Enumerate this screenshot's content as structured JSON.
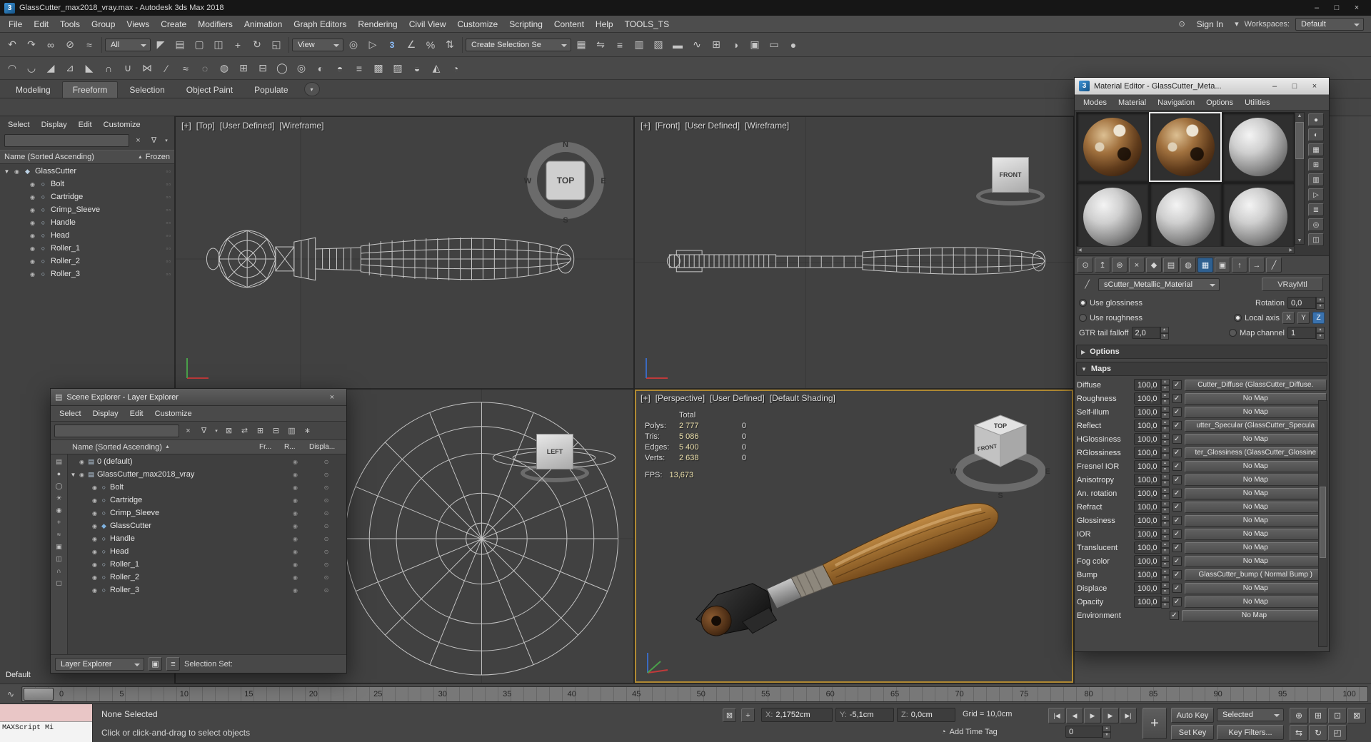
{
  "icons": {
    "eye": "◉",
    "gear": "▫▫",
    "render_col": "◉",
    "display_col": "⊙",
    "search_clear": "×",
    "funnel": "∇",
    "caret_down": "▾",
    "sort_asc": "▲",
    "check": "✓",
    "spin_up": "▲",
    "spin_down": "▼",
    "scroll_up": "▲",
    "scroll_down": "▼",
    "scroll_left": "◀",
    "scroll_right": "▶",
    "eyedropper": "╱",
    "person": "⊙",
    "lock": "⊠",
    "offset_mode": "+",
    "clock": "◔",
    "minicurve": "∿",
    "layer": "▤"
  },
  "titlebar": {
    "app_icon": "3",
    "title": "GlassCutter_max2018_vray.max - Autodesk 3ds Max 2018",
    "minimize": "–",
    "maximize": "□",
    "close": "×"
  },
  "menubar": {
    "items": [
      "File",
      "Edit",
      "Tools",
      "Group",
      "Views",
      "Create",
      "Modifiers",
      "Animation",
      "Graph Editors",
      "Rendering",
      "Civil View",
      "Customize",
      "Scripting",
      "Content",
      "Help",
      "TOOLS_TS"
    ],
    "sign_in": "Sign In",
    "workspaces_label": "Workspaces:",
    "workspace_value": "Default"
  },
  "toolbar_main": {
    "filter_dropdown": "All",
    "coords_dropdown": "View",
    "named_sets_dropdown": "Create Selection Se",
    "left_icons": [
      {
        "name": "undo-icon",
        "glyph": "↶"
      },
      {
        "name": "redo-icon",
        "glyph": "↷"
      },
      {
        "name": "select-and-link-icon",
        "glyph": "∞"
      },
      {
        "name": "unlink-selection-icon",
        "glyph": "⊘"
      },
      {
        "name": "bind-to-space-warp-icon",
        "glyph": "≈"
      }
    ],
    "select_icons": [
      {
        "name": "select-object-icon",
        "glyph": "◤"
      },
      {
        "name": "select-by-name-icon",
        "glyph": "▤"
      },
      {
        "name": "rectangular-selection-icon",
        "glyph": "▢"
      },
      {
        "name": "window-crossing-icon",
        "glyph": "◫"
      },
      {
        "name": "select-and-move-icon",
        "glyph": "+"
      },
      {
        "name": "select-and-rotate-icon",
        "glyph": "↻"
      },
      {
        "name": "select-and-scale-icon",
        "glyph": "◱"
      }
    ],
    "mid_icons": [
      {
        "name": "use-pivot-center-icon",
        "glyph": "◎"
      },
      {
        "name": "select-and-manipulate-icon",
        "glyph": "▷"
      },
      {
        "name": "snap-toggle-icon",
        "glyph": "3",
        "class": "snap"
      },
      {
        "name": "angle-snap-icon",
        "glyph": "∠"
      },
      {
        "name": "percent-snap-icon",
        "glyph": "%"
      },
      {
        "name": "spinner-snap-icon",
        "glyph": "⇅"
      }
    ],
    "right_icons": [
      {
        "name": "edit-named-selections-icon",
        "glyph": "▦"
      },
      {
        "name": "mirror-icon",
        "glyph": "⇋"
      },
      {
        "name": "align-icon",
        "glyph": "≡"
      },
      {
        "name": "toggle-scene-explorer-icon",
        "glyph": "▥"
      },
      {
        "name": "toggle-layer-explorer-icon",
        "glyph": "▧"
      },
      {
        "name": "toggle-ribbon-icon",
        "glyph": "▬"
      },
      {
        "name": "curve-editor-icon",
        "glyph": "∿"
      },
      {
        "name": "schematic-view-icon",
        "glyph": "⊞"
      },
      {
        "name": "material-editor-icon",
        "glyph": "◑"
      },
      {
        "name": "render-setup-icon",
        "glyph": "▣"
      },
      {
        "name": "rendered-frame-window-icon",
        "glyph": "▭"
      },
      {
        "name": "render-production-icon",
        "glyph": "●"
      }
    ]
  },
  "toolbar_second": {
    "icons": [
      {
        "name": "paint-connect-icon",
        "glyph": "◠"
      },
      {
        "name": "swift-loop-icon",
        "glyph": "◡"
      },
      {
        "name": "chamfer-icon",
        "glyph": "◢"
      },
      {
        "name": "extrude-icon",
        "glyph": "⊿"
      },
      {
        "name": "bevel-icon",
        "glyph": "◣"
      },
      {
        "name": "bridge-icon",
        "glyph": "∩"
      },
      {
        "name": "weld-icon",
        "glyph": "∪"
      },
      {
        "name": "cut-icon",
        "glyph": "⋈"
      },
      {
        "name": "quickslice-icon",
        "glyph": "∕"
      },
      {
        "name": "relax-icon",
        "glyph": "≈"
      },
      {
        "name": "soft-selection-icon",
        "glyph": "◌"
      },
      {
        "name": "paint-selection-icon",
        "glyph": "◍"
      },
      {
        "name": "grow-selection-icon",
        "glyph": "⊞"
      },
      {
        "name": "shrink-selection-icon",
        "glyph": "⊟"
      },
      {
        "name": "edge-loop-icon",
        "glyph": "◯"
      },
      {
        "name": "edge-ring-icon",
        "glyph": "◎"
      },
      {
        "name": "ignore-backfacing-icon",
        "glyph": "◐"
      },
      {
        "name": "nurms-toggle-icon",
        "glyph": "◓"
      },
      {
        "name": "isoline-display-icon",
        "glyph": "≡"
      },
      {
        "name": "show-cage-icon",
        "glyph": "▩"
      },
      {
        "name": "preserve-uvs-icon",
        "glyph": "▨"
      },
      {
        "name": "turbosmooth-icon",
        "glyph": "◒"
      },
      {
        "name": "symmetry-icon",
        "glyph": "◭"
      },
      {
        "name": "shell-icon",
        "glyph": "◔"
      }
    ]
  },
  "ribbon": {
    "tabs": [
      {
        "label": "Modeling"
      },
      {
        "label": "Freeform",
        "class": "active"
      },
      {
        "label": "Selection"
      },
      {
        "label": "Object Paint"
      },
      {
        "label": "Populate"
      }
    ]
  },
  "dock_explorer": {
    "menu": [
      "Select",
      "Display",
      "Edit",
      "Customize"
    ],
    "header_name": "Name (Sorted Ascending)",
    "header_frozen": "Frozen",
    "rows": [
      {
        "label": "GlassCutter",
        "expander": "▼",
        "icon_glyph": "◆",
        "level": 0
      },
      {
        "label": "Bolt",
        "icon_glyph": "○",
        "level": 1
      },
      {
        "label": "Cartridge",
        "icon_glyph": "○",
        "level": 1
      },
      {
        "label": "Crimp_Sleeve",
        "icon_glyph": "○",
        "level": 1
      },
      {
        "label": "Handle",
        "icon_glyph": "○",
        "level": 1
      },
      {
        "label": "Head",
        "icon_glyph": "○",
        "level": 1
      },
      {
        "label": "Roller_1",
        "icon_glyph": "○",
        "level": 1
      },
      {
        "label": "Roller_2",
        "icon_glyph": "○",
        "level": 1
      },
      {
        "label": "Roller_3",
        "icon_glyph": "○",
        "level": 1
      }
    ],
    "footer": "Default"
  },
  "viewports": {
    "top": {
      "plus": "[+]",
      "name": "[Top]",
      "pov": "[User Defined]",
      "shading": "[Wireframe]",
      "cube": "TOP",
      "compass": {
        "n": "N",
        "e": "E",
        "s": "S",
        "w": "W"
      }
    },
    "front": {
      "plus": "[+]",
      "name": "[Front]",
      "pov": "[User Defined]",
      "shading": "[Wireframe]",
      "cube": "FRONT"
    },
    "left": {
      "cube": "LEFT"
    },
    "persp": {
      "plus": "[+]",
      "name": "[Perspective]",
      "pov": "[User Defined]",
      "shading": "[Default Shading]",
      "cube_top": "TOP",
      "cube_front": "FRONT",
      "compass": {
        "w": "W",
        "s": "S",
        "e": "E"
      },
      "stats": {
        "header": "Total",
        "rows": [
          {
            "label": "Polys:",
            "value": "2 777",
            "extra": "0"
          },
          {
            "label": "Tris:",
            "value": "5 086",
            "extra": "0"
          },
          {
            "label": "Edges:",
            "value": "5 400",
            "extra": "0"
          },
          {
            "label": "Verts:",
            "value": "2 638",
            "extra": "0"
          }
        ],
        "fps_label": "FPS:",
        "fps_value": "13,673"
      }
    }
  },
  "layer_explorer": {
    "title": "Scene Explorer - Layer Explorer",
    "menu": [
      "Select",
      "Display",
      "Edit",
      "Customize"
    ],
    "toolbar_icons": [
      {
        "name": "lock-explorer-icon",
        "glyph": "⊠"
      },
      {
        "name": "sync-selection-icon",
        "glyph": "⇄"
      },
      {
        "name": "expand-all-icon",
        "glyph": "⊞"
      },
      {
        "name": "collapse-all-icon",
        "glyph": "⊟"
      },
      {
        "name": "hide-by-category-icon",
        "glyph": "▥"
      },
      {
        "name": "freeze-toggle-icon",
        "glyph": "∗"
      }
    ],
    "left_icons": [
      {
        "name": "display-all-icon",
        "glyph": "▤"
      },
      {
        "name": "display-geometry-icon",
        "glyph": "●"
      },
      {
        "name": "display-shapes-icon",
        "glyph": "◯"
      },
      {
        "name": "display-lights-icon",
        "glyph": "☀"
      },
      {
        "name": "display-cameras-icon",
        "glyph": "◉"
      },
      {
        "name": "display-helpers-icon",
        "glyph": "+"
      },
      {
        "name": "display-spacewarps-icon",
        "glyph": "≈"
      },
      {
        "name": "display-groups-icon",
        "glyph": "▣"
      },
      {
        "name": "display-xrefs-icon",
        "glyph": "◫"
      },
      {
        "name": "display-bones-icon",
        "glyph": "∩"
      },
      {
        "name": "display-containers-icon",
        "glyph": "▢"
      }
    ],
    "columns": {
      "name": "Name (Sorted Ascending)",
      "fr": "Fr...",
      "r": "R...",
      "displa": "Displa..."
    },
    "rows": [
      {
        "label": "0 (default)",
        "icon_glyph": "▤",
        "level": 0
      },
      {
        "label": "GlassCutter_max2018_vray",
        "expander": "▼",
        "icon_glyph": "▤",
        "level": 0
      },
      {
        "label": "Bolt",
        "icon_glyph": "○",
        "level": 1
      },
      {
        "label": "Cartridge",
        "icon_glyph": "○",
        "level": 1
      },
      {
        "label": "Crimp_Sleeve",
        "icon_glyph": "○",
        "level": 1
      },
      {
        "label": "GlassCutter",
        "icon_glyph": "◆",
        "level": 1,
        "class": "geo"
      },
      {
        "label": "Handle",
        "icon_glyph": "○",
        "level": 1
      },
      {
        "label": "Head",
        "icon_glyph": "○",
        "level": 1
      },
      {
        "label": "Roller_1",
        "icon_glyph": "○",
        "level": 1
      },
      {
        "label": "Roller_2",
        "icon_glyph": "○",
        "level": 1
      },
      {
        "label": "Roller_3",
        "icon_glyph": "○",
        "level": 1
      }
    ],
    "footer_dropdown": "Layer Explorer",
    "footer_icons": [
      {
        "name": "pin-explorer-icon",
        "glyph": "▣"
      },
      {
        "name": "explorer-settings-icon",
        "glyph": "≡"
      }
    ],
    "footer_label": "Selection Set:"
  },
  "material_editor": {
    "app_icon": "3",
    "title": "Material Editor - GlassCutter_Meta...",
    "minimize": "–",
    "maximize": "□",
    "close": "×",
    "menu": [
      "Modes",
      "Material",
      "Navigation",
      "Options",
      "Utilities"
    ],
    "slots": [
      {
        "class": "tex"
      },
      {
        "class": "tex active"
      },
      {
        "class": "plain"
      },
      {
        "class": "plain"
      },
      {
        "class": "plain"
      },
      {
        "class": "plain"
      }
    ],
    "side_icons": [
      {
        "name": "sample-type-icon",
        "glyph": "●"
      },
      {
        "name": "backlight-icon",
        "glyph": "◐"
      },
      {
        "name": "sample-background-icon",
        "glyph": "▦"
      },
      {
        "name": "sample-tiling-icon",
        "glyph": "⊞"
      },
      {
        "name": "video-color-check-icon",
        "glyph": "▥"
      },
      {
        "name": "make-preview-icon",
        "glyph": "▷"
      },
      {
        "name": "material-editor-options-icon",
        "glyph": "≣"
      },
      {
        "name": "select-by-material-icon",
        "glyph": "◎"
      },
      {
        "name": "material-map-navigator-icon",
        "glyph": "◫"
      }
    ],
    "tool_icons": [
      {
        "name": "get-material-icon",
        "glyph": "⊙"
      },
      {
        "name": "put-material-to-scene-icon",
        "glyph": "↥"
      },
      {
        "name": "assign-material-to-selection-icon",
        "glyph": "⊚"
      },
      {
        "name": "reset-map-icon",
        "glyph": "×"
      },
      {
        "name": "make-material-copy-icon",
        "glyph": "◆"
      },
      {
        "name": "put-to-library-icon",
        "glyph": "▤"
      },
      {
        "name": "material-id-channel-icon",
        "glyph": "◍"
      },
      {
        "name": "show-map-in-viewport-icon",
        "glyph": "▦",
        "class": "active"
      },
      {
        "name": "show-end-result-icon",
        "glyph": "▣"
      },
      {
        "name": "go-to-parent-icon",
        "glyph": "↑"
      },
      {
        "name": "go-forward-to-sibling-icon",
        "glyph": "→"
      },
      {
        "name": "pick-material-from-object-icon",
        "glyph": "╱"
      }
    ],
    "material_name": "sCutter_Metallic_Material",
    "material_type": "VRayMtl",
    "params": {
      "use_glossiness": "Use glossiness",
      "use_roughness": "Use roughness",
      "rotation_label": "Rotation",
      "rotation_value": "0,0",
      "local_axis_label": "Local axis",
      "axis_x": "X",
      "axis_y": "Y",
      "axis_z": "Z",
      "gtr_label": "GTR tail falloff",
      "gtr_value": "2,0",
      "map_channel_label": "Map channel",
      "map_channel_value": "1"
    },
    "rollouts": {
      "options": "Options",
      "maps": "Maps"
    },
    "maps": [
      {
        "label": "Diffuse",
        "amount": "100,0",
        "map": "Cutter_Diffuse (GlassCutter_Diffuse."
      },
      {
        "label": "Roughness",
        "amount": "100,0",
        "map": "No Map"
      },
      {
        "label": "Self-illum",
        "amount": "100,0",
        "map": "No Map"
      },
      {
        "label": "Reflect",
        "amount": "100,0",
        "map": "utter_Specular (GlassCutter_Specula"
      },
      {
        "label": "HGlossiness",
        "amount": "100,0",
        "map": "No Map"
      },
      {
        "label": "RGlossiness",
        "amount": "100,0",
        "map": "ter_Glossiness (GlassCutter_Glossine"
      },
      {
        "label": "Fresnel IOR",
        "amount": "100,0",
        "map": "No Map"
      },
      {
        "label": "Anisotropy",
        "amount": "100,0",
        "map": "No Map"
      },
      {
        "label": "An. rotation",
        "amount": "100,0",
        "map": "No Map"
      },
      {
        "label": "Refract",
        "amount": "100,0",
        "map": "No Map"
      },
      {
        "label": "Glossiness",
        "amount": "100,0",
        "map": "No Map"
      },
      {
        "label": "IOR",
        "amount": "100,0",
        "map": "No Map"
      },
      {
        "label": "Translucent",
        "amount": "100,0",
        "map": "No Map"
      },
      {
        "label": "Fog color",
        "amount": "100,0",
        "map": "No Map"
      },
      {
        "label": "Bump",
        "amount": "100,0",
        "map": "GlassCutter_bump ( Normal Bump )"
      },
      {
        "label": "Displace",
        "amount": "100,0",
        "map": "No Map"
      },
      {
        "label": "Opacity",
        "amount": "100,0",
        "map": "No Map"
      },
      {
        "label": "Environment",
        "amount": "",
        "map": "No Map"
      }
    ]
  },
  "timeline": {
    "ticks": [
      "0",
      "5",
      "10",
      "15",
      "20",
      "25",
      "30",
      "35",
      "40",
      "45",
      "50",
      "55",
      "60",
      "65",
      "70",
      "75",
      "80",
      "85",
      "90",
      "95",
      "100"
    ]
  },
  "statusbar": {
    "listener_text": "MAXScript Mi",
    "none_selected": "None Selected",
    "prompt": "Click or click-and-drag to select objects",
    "coords": {
      "x_label": "X:",
      "x": "2,1752cm",
      "y_label": "Y:",
      "y": "-5,1cm",
      "z_label": "Z:",
      "z": "0,0cm"
    },
    "grid_label": "Grid = 10,0cm",
    "add_time_tag": "Add Time Tag",
    "transport": [
      {
        "name": "go-to-start-icon",
        "glyph": "|◀"
      },
      {
        "name": "previous-frame-icon",
        "glyph": "◀"
      },
      {
        "name": "play-icon",
        "glyph": "▶"
      },
      {
        "name": "next-frame-icon",
        "glyph": "▶"
      },
      {
        "name": "go-to-end-icon",
        "glyph": "▶|"
      }
    ],
    "set_keys_button": "+",
    "auto_key": "Auto Key",
    "selected_dropdown": "Selected",
    "set_key": "Set Key",
    "key_filters": "Key Filters...",
    "time_value": "0",
    "nav_row1": [
      {
        "name": "zoom-icon",
        "glyph": "⊕"
      },
      {
        "name": "zoom-all-icon",
        "glyph": "⊞"
      },
      {
        "name": "zoom-extents-icon",
        "glyph": "⊡"
      },
      {
        "name": "zoom-region-icon",
        "glyph": "⊠"
      }
    ],
    "nav_row2": [
      {
        "name": "pan-icon",
        "glyph": "⇆"
      },
      {
        "name": "orbit-icon",
        "glyph": "↻"
      },
      {
        "name": "maximize-viewport-toggle-icon",
        "glyph": "◰"
      }
    ]
  }
}
